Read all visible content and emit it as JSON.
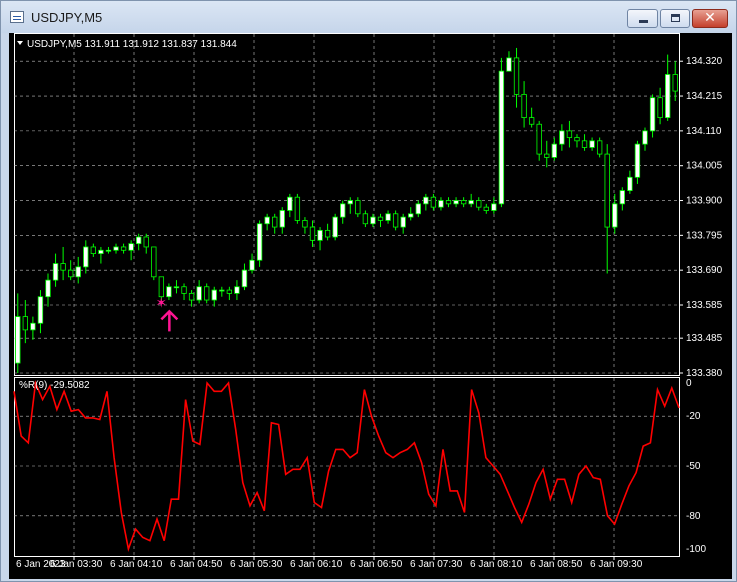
{
  "window": {
    "title": "USDJPY,M5"
  },
  "main_chart": {
    "info": "USDJPY,M5  131.911 131.912 131.837 131.844",
    "price_labels": [
      "134.320",
      "134.215",
      "134.110",
      "134.005",
      "133.900",
      "133.795",
      "133.690",
      "133.585",
      "133.485",
      "133.380"
    ]
  },
  "indicator": {
    "label": "%R(9) -29.5082",
    "levels": [
      "0",
      "-20",
      "-50",
      "-80",
      "-100"
    ]
  },
  "time_labels": [
    "6 Jan 2023",
    "6 Jan 03:30",
    "6 Jan 04:10",
    "6 Jan 04:50",
    "6 Jan 05:30",
    "6 Jan 06:10",
    "6 Jan 06:50",
    "6 Jan 07:30",
    "6 Jan 08:10",
    "6 Jan 08:50",
    "6 Jan 09:30"
  ],
  "colors": {
    "background": "#000000",
    "grid": "#c0c0c0",
    "candle_up": "#00ff00",
    "candle_up_body": "#ffffff",
    "indicator_line": "#ff0000",
    "signal": "#ff1493"
  },
  "chart_data": {
    "type": "candlestick",
    "y_range": [
      133.38,
      134.39
    ],
    "candles": [
      [
        133.41,
        133.62,
        133.38,
        133.55
      ],
      [
        133.55,
        133.6,
        133.47,
        133.51
      ],
      [
        133.51,
        133.55,
        133.48,
        133.53
      ],
      [
        133.53,
        133.63,
        133.5,
        133.61
      ],
      [
        133.61,
        133.68,
        133.58,
        133.66
      ],
      [
        133.66,
        133.74,
        133.64,
        133.71
      ],
      [
        133.71,
        133.76,
        133.66,
        133.69
      ],
      [
        133.69,
        133.72,
        133.66,
        133.67
      ],
      [
        133.67,
        133.73,
        133.65,
        133.7
      ],
      [
        133.7,
        133.78,
        133.68,
        133.76
      ],
      [
        133.76,
        133.77,
        133.73,
        133.74
      ],
      [
        133.74,
        133.76,
        133.71,
        133.75
      ],
      [
        133.75,
        133.76,
        133.74,
        133.75
      ],
      [
        133.75,
        133.77,
        133.74,
        133.76
      ],
      [
        133.76,
        133.77,
        133.74,
        133.75
      ],
      [
        133.75,
        133.78,
        133.72,
        133.77
      ],
      [
        133.77,
        133.8,
        133.75,
        133.79
      ],
      [
        133.79,
        133.8,
        133.74,
        133.76
      ],
      [
        133.76,
        133.76,
        133.66,
        133.67
      ],
      [
        133.67,
        133.67,
        133.59,
        133.61
      ],
      [
        133.61,
        133.65,
        133.6,
        133.64
      ],
      [
        133.64,
        133.66,
        133.62,
        133.64
      ],
      [
        133.64,
        133.65,
        133.6,
        133.62
      ],
      [
        133.62,
        133.63,
        133.58,
        133.6
      ],
      [
        133.6,
        133.66,
        133.59,
        133.64
      ],
      [
        133.64,
        133.65,
        133.59,
        133.6
      ],
      [
        133.6,
        133.64,
        133.58,
        133.63
      ],
      [
        133.63,
        133.64,
        133.61,
        133.63
      ],
      [
        133.63,
        133.64,
        133.6,
        133.62
      ],
      [
        133.62,
        133.66,
        133.6,
        133.64
      ],
      [
        133.64,
        133.71,
        133.63,
        133.69
      ],
      [
        133.69,
        133.74,
        133.68,
        133.72
      ],
      [
        133.72,
        133.84,
        133.7,
        133.83
      ],
      [
        133.83,
        133.86,
        133.81,
        133.85
      ],
      [
        133.85,
        133.86,
        133.8,
        133.82
      ],
      [
        133.82,
        133.88,
        133.8,
        133.87
      ],
      [
        133.87,
        133.92,
        133.85,
        133.91
      ],
      [
        133.91,
        133.92,
        133.83,
        133.84
      ],
      [
        133.84,
        133.85,
        133.8,
        133.82
      ],
      [
        133.82,
        133.84,
        133.76,
        133.78
      ],
      [
        133.78,
        133.82,
        133.75,
        133.81
      ],
      [
        133.81,
        133.83,
        133.78,
        133.79
      ],
      [
        133.79,
        133.86,
        133.78,
        133.85
      ],
      [
        133.85,
        133.9,
        133.83,
        133.89
      ],
      [
        133.89,
        133.91,
        133.86,
        133.9
      ],
      [
        133.9,
        133.91,
        133.85,
        133.86
      ],
      [
        133.86,
        133.87,
        133.82,
        133.83
      ],
      [
        133.83,
        133.86,
        133.82,
        133.85
      ],
      [
        133.85,
        133.86,
        133.82,
        133.84
      ],
      [
        133.84,
        133.87,
        133.83,
        133.86
      ],
      [
        133.86,
        133.87,
        133.81,
        133.82
      ],
      [
        133.82,
        133.86,
        133.8,
        133.85
      ],
      [
        133.85,
        133.88,
        133.84,
        133.86
      ],
      [
        133.86,
        133.9,
        133.85,
        133.89
      ],
      [
        133.89,
        133.92,
        133.87,
        133.91
      ],
      [
        133.91,
        133.92,
        133.87,
        133.88
      ],
      [
        133.88,
        133.91,
        133.87,
        133.9
      ],
      [
        133.9,
        133.91,
        133.88,
        133.89
      ],
      [
        133.89,
        133.91,
        133.88,
        133.9
      ],
      [
        133.9,
        133.91,
        133.88,
        133.89
      ],
      [
        133.89,
        133.92,
        133.88,
        133.9
      ],
      [
        133.9,
        133.91,
        133.87,
        133.88
      ],
      [
        133.88,
        133.89,
        133.86,
        133.87
      ],
      [
        133.87,
        133.91,
        133.86,
        133.89
      ],
      [
        133.89,
        134.33,
        133.88,
        134.29
      ],
      [
        134.29,
        134.35,
        134.3,
        134.33
      ],
      [
        134.33,
        134.36,
        134.18,
        134.22
      ],
      [
        134.22,
        134.26,
        134.12,
        134.15
      ],
      [
        134.15,
        134.18,
        134.12,
        134.13
      ],
      [
        134.13,
        134.14,
        134.02,
        134.04
      ],
      [
        134.04,
        134.08,
        134.0,
        134.03
      ],
      [
        134.03,
        134.09,
        134.02,
        134.07
      ],
      [
        134.07,
        134.13,
        134.05,
        134.11
      ],
      [
        134.11,
        134.14,
        134.06,
        134.09
      ],
      [
        134.09,
        134.1,
        134.06,
        134.08
      ],
      [
        134.08,
        134.1,
        134.05,
        134.06
      ],
      [
        134.06,
        134.09,
        134.05,
        134.08
      ],
      [
        134.08,
        134.09,
        134.03,
        134.04
      ],
      [
        134.04,
        134.07,
        133.68,
        133.82
      ],
      [
        133.82,
        133.92,
        133.8,
        133.89
      ],
      [
        133.89,
        133.94,
        133.87,
        133.93
      ],
      [
        133.93,
        133.99,
        133.92,
        133.97
      ],
      [
        133.97,
        134.08,
        133.95,
        134.07
      ],
      [
        134.07,
        134.12,
        134.05,
        134.11
      ],
      [
        134.11,
        134.22,
        134.09,
        134.21
      ],
      [
        134.21,
        134.24,
        134.13,
        134.15
      ],
      [
        134.15,
        134.34,
        134.14,
        134.28
      ],
      [
        134.28,
        134.32,
        134.2,
        134.23
      ]
    ],
    "signal": {
      "type": "buy-arrow",
      "candle": 19,
      "price": 133.59
    },
    "williams_r": {
      "name": "%R(9)",
      "range": [
        -100,
        0
      ],
      "values": [
        -5,
        -32,
        -36,
        0,
        -10,
        -2,
        -16,
        -5,
        -17,
        -16,
        -21,
        -21,
        -22,
        -5,
        -45,
        -78,
        -100,
        -88,
        -93,
        -95,
        -82,
        -95,
        -70,
        -70,
        -10,
        -35,
        -37,
        0,
        -5,
        -5,
        0,
        -28,
        -60,
        -74,
        -66,
        -77,
        -24,
        -25,
        -55,
        -52,
        -52,
        -45,
        -72,
        -75,
        -53,
        -40,
        -40,
        -45,
        -42,
        -4,
        -20,
        -32,
        -42,
        -45,
        -42,
        -40,
        -36,
        -48,
        -67,
        -74,
        -40,
        -65,
        -65,
        -78,
        -4,
        -18,
        -45,
        -50,
        -55,
        -65,
        -75,
        -84,
        -73,
        -60,
        -52,
        -70,
        -58,
        -58,
        -72,
        -55,
        -50,
        -57,
        -58,
        -80,
        -85,
        -73,
        -62,
        -54,
        -38,
        -36,
        -4,
        -14,
        -3,
        -15
      ]
    }
  }
}
